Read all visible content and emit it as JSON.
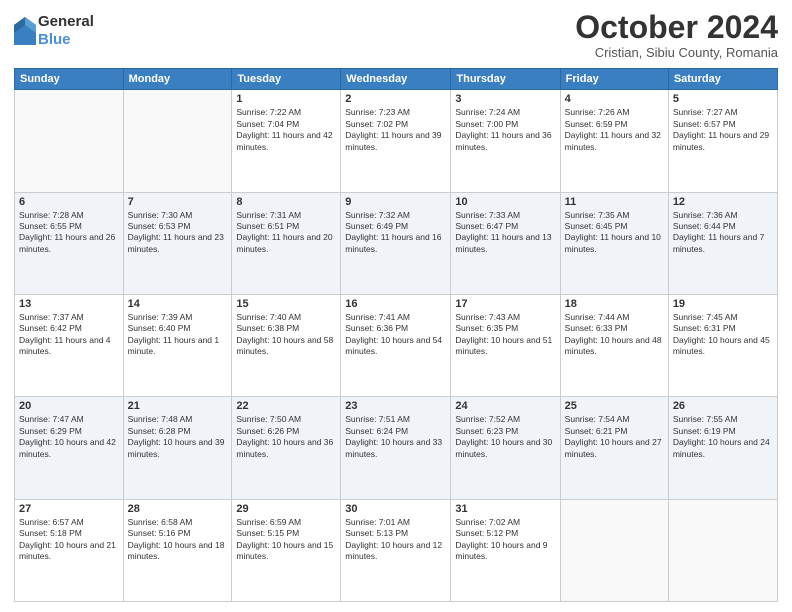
{
  "header": {
    "logo": {
      "general": "General",
      "blue": "Blue"
    },
    "title": "October 2024",
    "subtitle": "Cristian, Sibiu County, Romania"
  },
  "weekdays": [
    "Sunday",
    "Monday",
    "Tuesday",
    "Wednesday",
    "Thursday",
    "Friday",
    "Saturday"
  ],
  "weeks": [
    [
      {
        "day": "",
        "content": ""
      },
      {
        "day": "",
        "content": ""
      },
      {
        "day": "1",
        "content": "Sunrise: 7:22 AM\nSunset: 7:04 PM\nDaylight: 11 hours and 42 minutes."
      },
      {
        "day": "2",
        "content": "Sunrise: 7:23 AM\nSunset: 7:02 PM\nDaylight: 11 hours and 39 minutes."
      },
      {
        "day": "3",
        "content": "Sunrise: 7:24 AM\nSunset: 7:00 PM\nDaylight: 11 hours and 36 minutes."
      },
      {
        "day": "4",
        "content": "Sunrise: 7:26 AM\nSunset: 6:59 PM\nDaylight: 11 hours and 32 minutes."
      },
      {
        "day": "5",
        "content": "Sunrise: 7:27 AM\nSunset: 6:57 PM\nDaylight: 11 hours and 29 minutes."
      }
    ],
    [
      {
        "day": "6",
        "content": "Sunrise: 7:28 AM\nSunset: 6:55 PM\nDaylight: 11 hours and 26 minutes."
      },
      {
        "day": "7",
        "content": "Sunrise: 7:30 AM\nSunset: 6:53 PM\nDaylight: 11 hours and 23 minutes."
      },
      {
        "day": "8",
        "content": "Sunrise: 7:31 AM\nSunset: 6:51 PM\nDaylight: 11 hours and 20 minutes."
      },
      {
        "day": "9",
        "content": "Sunrise: 7:32 AM\nSunset: 6:49 PM\nDaylight: 11 hours and 16 minutes."
      },
      {
        "day": "10",
        "content": "Sunrise: 7:33 AM\nSunset: 6:47 PM\nDaylight: 11 hours and 13 minutes."
      },
      {
        "day": "11",
        "content": "Sunrise: 7:35 AM\nSunset: 6:45 PM\nDaylight: 11 hours and 10 minutes."
      },
      {
        "day": "12",
        "content": "Sunrise: 7:36 AM\nSunset: 6:44 PM\nDaylight: 11 hours and 7 minutes."
      }
    ],
    [
      {
        "day": "13",
        "content": "Sunrise: 7:37 AM\nSunset: 6:42 PM\nDaylight: 11 hours and 4 minutes."
      },
      {
        "day": "14",
        "content": "Sunrise: 7:39 AM\nSunset: 6:40 PM\nDaylight: 11 hours and 1 minute."
      },
      {
        "day": "15",
        "content": "Sunrise: 7:40 AM\nSunset: 6:38 PM\nDaylight: 10 hours and 58 minutes."
      },
      {
        "day": "16",
        "content": "Sunrise: 7:41 AM\nSunset: 6:36 PM\nDaylight: 10 hours and 54 minutes."
      },
      {
        "day": "17",
        "content": "Sunrise: 7:43 AM\nSunset: 6:35 PM\nDaylight: 10 hours and 51 minutes."
      },
      {
        "day": "18",
        "content": "Sunrise: 7:44 AM\nSunset: 6:33 PM\nDaylight: 10 hours and 48 minutes."
      },
      {
        "day": "19",
        "content": "Sunrise: 7:45 AM\nSunset: 6:31 PM\nDaylight: 10 hours and 45 minutes."
      }
    ],
    [
      {
        "day": "20",
        "content": "Sunrise: 7:47 AM\nSunset: 6:29 PM\nDaylight: 10 hours and 42 minutes."
      },
      {
        "day": "21",
        "content": "Sunrise: 7:48 AM\nSunset: 6:28 PM\nDaylight: 10 hours and 39 minutes."
      },
      {
        "day": "22",
        "content": "Sunrise: 7:50 AM\nSunset: 6:26 PM\nDaylight: 10 hours and 36 minutes."
      },
      {
        "day": "23",
        "content": "Sunrise: 7:51 AM\nSunset: 6:24 PM\nDaylight: 10 hours and 33 minutes."
      },
      {
        "day": "24",
        "content": "Sunrise: 7:52 AM\nSunset: 6:23 PM\nDaylight: 10 hours and 30 minutes."
      },
      {
        "day": "25",
        "content": "Sunrise: 7:54 AM\nSunset: 6:21 PM\nDaylight: 10 hours and 27 minutes."
      },
      {
        "day": "26",
        "content": "Sunrise: 7:55 AM\nSunset: 6:19 PM\nDaylight: 10 hours and 24 minutes."
      }
    ],
    [
      {
        "day": "27",
        "content": "Sunrise: 6:57 AM\nSunset: 5:18 PM\nDaylight: 10 hours and 21 minutes."
      },
      {
        "day": "28",
        "content": "Sunrise: 6:58 AM\nSunset: 5:16 PM\nDaylight: 10 hours and 18 minutes."
      },
      {
        "day": "29",
        "content": "Sunrise: 6:59 AM\nSunset: 5:15 PM\nDaylight: 10 hours and 15 minutes."
      },
      {
        "day": "30",
        "content": "Sunrise: 7:01 AM\nSunset: 5:13 PM\nDaylight: 10 hours and 12 minutes."
      },
      {
        "day": "31",
        "content": "Sunrise: 7:02 AM\nSunset: 5:12 PM\nDaylight: 10 hours and 9 minutes."
      },
      {
        "day": "",
        "content": ""
      },
      {
        "day": "",
        "content": ""
      }
    ]
  ]
}
